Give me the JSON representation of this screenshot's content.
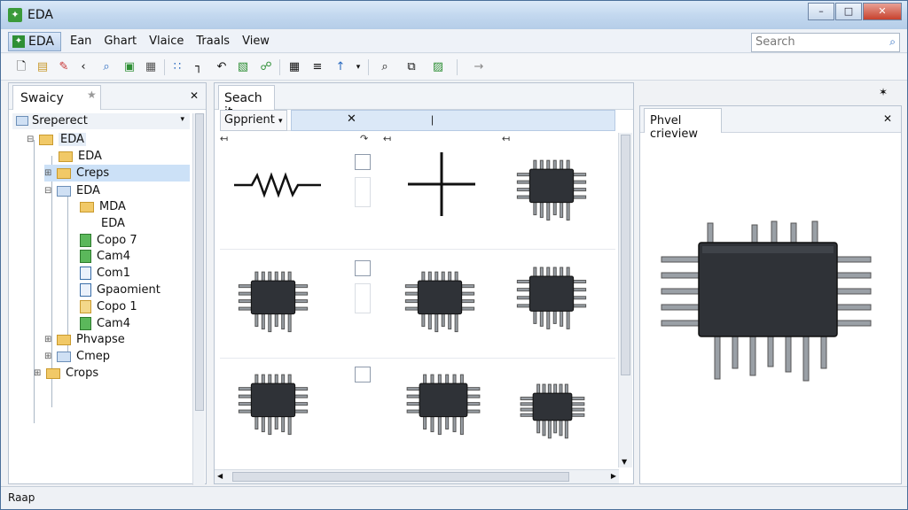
{
  "window": {
    "title": "EDA"
  },
  "menubar": {
    "app_label": "EDA",
    "items": [
      "Ean",
      "Ghart",
      "Vlaice",
      "Traals",
      "View"
    ],
    "search_placeholder": "Search"
  },
  "left_panel": {
    "tab_label": "Swaicy",
    "root_label": "Sreperect",
    "tree": [
      {
        "label": "EDA",
        "type": "folder",
        "selected": false
      },
      {
        "label": "EDA",
        "type": "folder"
      },
      {
        "label": "Creps",
        "type": "folder",
        "selected": true
      },
      {
        "label": "EDA",
        "type": "folder-blue"
      },
      {
        "label": "MDA",
        "type": "folder"
      },
      {
        "label": "EDA",
        "type": "none"
      },
      {
        "label": "Copo 7",
        "type": "green"
      },
      {
        "label": "Cam4",
        "type": "green"
      },
      {
        "label": "Com1",
        "type": "doc"
      },
      {
        "label": "Gpaomient",
        "type": "doc"
      },
      {
        "label": "Copo 1",
        "type": "folddoc"
      },
      {
        "label": "Cam4",
        "type": "green"
      },
      {
        "label": "Phvapse",
        "type": "folder"
      },
      {
        "label": "Cmep",
        "type": "folder-blue"
      },
      {
        "label": "Crops",
        "type": "folder"
      }
    ]
  },
  "middle_panel": {
    "tab_label": "Seach it",
    "sub_label": "Gpprient"
  },
  "right_panel": {
    "tab_label": "Phvel crieview"
  },
  "statusbar": {
    "text": "Raap"
  }
}
